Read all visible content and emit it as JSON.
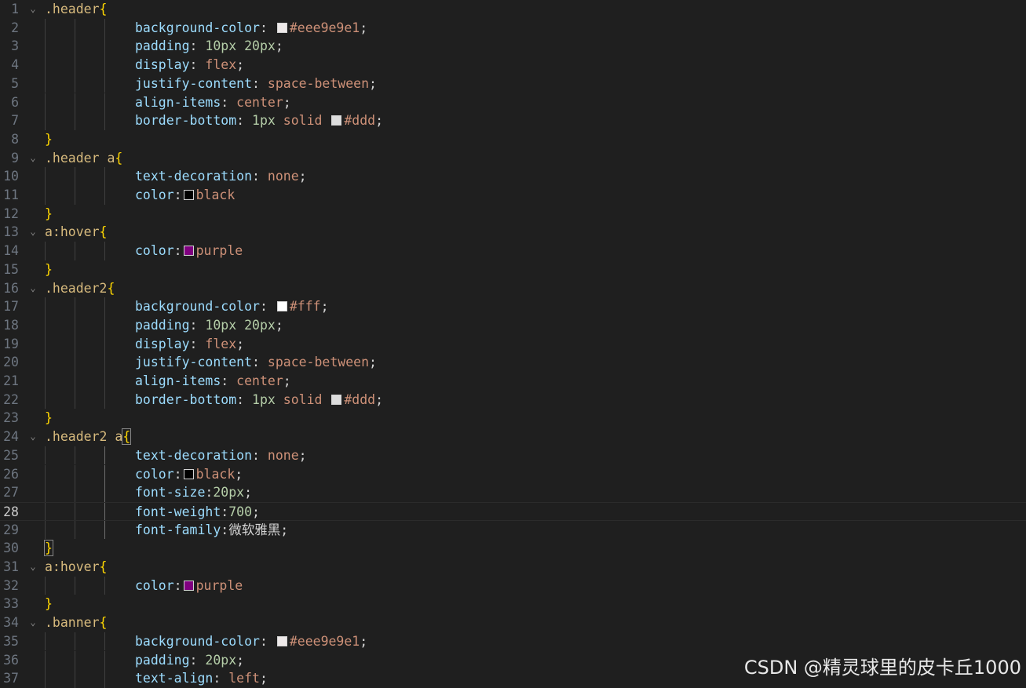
{
  "editor": {
    "current_line": 28,
    "lines": [
      {
        "n": "1",
        "fold": true,
        "indent": 0,
        "tokens": [
          {
            "t": ".header",
            "c": "sel"
          },
          {
            "t": "{",
            "c": "brace"
          }
        ]
      },
      {
        "n": "2",
        "fold": false,
        "indent": 1,
        "tokens": [
          {
            "t": "background-color",
            "c": "prop"
          },
          {
            "t": ": ",
            "c": "punc"
          },
          {
            "sw": "#eee9e9"
          },
          {
            "t": "#eee9e9e1",
            "c": "val"
          },
          {
            "t": ";",
            "c": "punc"
          }
        ]
      },
      {
        "n": "3",
        "fold": false,
        "indent": 1,
        "tokens": [
          {
            "t": "padding",
            "c": "prop"
          },
          {
            "t": ": ",
            "c": "punc"
          },
          {
            "t": "10px 20px",
            "c": "num"
          },
          {
            "t": ";",
            "c": "punc"
          }
        ]
      },
      {
        "n": "4",
        "fold": false,
        "indent": 1,
        "tokens": [
          {
            "t": "display",
            "c": "prop"
          },
          {
            "t": ": ",
            "c": "punc"
          },
          {
            "t": "flex",
            "c": "val"
          },
          {
            "t": ";",
            "c": "punc"
          }
        ]
      },
      {
        "n": "5",
        "fold": false,
        "indent": 1,
        "tokens": [
          {
            "t": "justify-content",
            "c": "prop"
          },
          {
            "t": ": ",
            "c": "punc"
          },
          {
            "t": "space-between",
            "c": "val"
          },
          {
            "t": ";",
            "c": "punc"
          }
        ]
      },
      {
        "n": "6",
        "fold": false,
        "indent": 1,
        "tokens": [
          {
            "t": "align-items",
            "c": "prop"
          },
          {
            "t": ": ",
            "c": "punc"
          },
          {
            "t": "center",
            "c": "val"
          },
          {
            "t": ";",
            "c": "punc"
          }
        ]
      },
      {
        "n": "7",
        "fold": false,
        "indent": 1,
        "tokens": [
          {
            "t": "border-bottom",
            "c": "prop"
          },
          {
            "t": ": ",
            "c": "punc"
          },
          {
            "t": "1px",
            "c": "num"
          },
          {
            "t": " solid ",
            "c": "val"
          },
          {
            "sw": "#dddddd"
          },
          {
            "t": "#ddd",
            "c": "val"
          },
          {
            "t": ";",
            "c": "punc"
          }
        ]
      },
      {
        "n": "8",
        "fold": false,
        "indent": 0,
        "tokens": [
          {
            "t": "}",
            "c": "brace"
          }
        ]
      },
      {
        "n": "9",
        "fold": true,
        "indent": 0,
        "tokens": [
          {
            "t": ".header a",
            "c": "sel"
          },
          {
            "t": "{",
            "c": "brace"
          }
        ]
      },
      {
        "n": "10",
        "fold": false,
        "indent": 1,
        "tokens": [
          {
            "t": "text-decoration",
            "c": "prop"
          },
          {
            "t": ": ",
            "c": "punc"
          },
          {
            "t": "none",
            "c": "val"
          },
          {
            "t": ";",
            "c": "punc"
          }
        ]
      },
      {
        "n": "11",
        "fold": false,
        "indent": 1,
        "tokens": [
          {
            "t": "color",
            "c": "prop"
          },
          {
            "t": ":",
            "c": "punc"
          },
          {
            "sw": "#000000"
          },
          {
            "t": "black",
            "c": "val"
          }
        ]
      },
      {
        "n": "12",
        "fold": false,
        "indent": 0,
        "tokens": [
          {
            "t": "}",
            "c": "brace"
          }
        ]
      },
      {
        "n": "13",
        "fold": true,
        "indent": 0,
        "tokens": [
          {
            "t": "a:hover",
            "c": "sel"
          },
          {
            "t": "{",
            "c": "brace"
          }
        ]
      },
      {
        "n": "14",
        "fold": false,
        "indent": 1,
        "tokens": [
          {
            "t": "color",
            "c": "prop"
          },
          {
            "t": ":",
            "c": "punc"
          },
          {
            "sw": "#800080"
          },
          {
            "t": "purple",
            "c": "val"
          }
        ]
      },
      {
        "n": "15",
        "fold": false,
        "indent": 0,
        "tokens": [
          {
            "t": "}",
            "c": "brace"
          }
        ]
      },
      {
        "n": "16",
        "fold": true,
        "indent": 0,
        "tokens": [
          {
            "t": ".header2",
            "c": "sel"
          },
          {
            "t": "{",
            "c": "brace"
          }
        ]
      },
      {
        "n": "17",
        "fold": false,
        "indent": 1,
        "tokens": [
          {
            "t": "background-color",
            "c": "prop"
          },
          {
            "t": ": ",
            "c": "punc"
          },
          {
            "sw": "#ffffff"
          },
          {
            "t": "#fff",
            "c": "val"
          },
          {
            "t": ";",
            "c": "punc"
          }
        ]
      },
      {
        "n": "18",
        "fold": false,
        "indent": 1,
        "tokens": [
          {
            "t": "padding",
            "c": "prop"
          },
          {
            "t": ": ",
            "c": "punc"
          },
          {
            "t": "10px 20px",
            "c": "num"
          },
          {
            "t": ";",
            "c": "punc"
          }
        ]
      },
      {
        "n": "19",
        "fold": false,
        "indent": 1,
        "tokens": [
          {
            "t": "display",
            "c": "prop"
          },
          {
            "t": ": ",
            "c": "punc"
          },
          {
            "t": "flex",
            "c": "val"
          },
          {
            "t": ";",
            "c": "punc"
          }
        ]
      },
      {
        "n": "20",
        "fold": false,
        "indent": 1,
        "tokens": [
          {
            "t": "justify-content",
            "c": "prop"
          },
          {
            "t": ": ",
            "c": "punc"
          },
          {
            "t": "space-between",
            "c": "val"
          },
          {
            "t": ";",
            "c": "punc"
          }
        ]
      },
      {
        "n": "21",
        "fold": false,
        "indent": 1,
        "tokens": [
          {
            "t": "align-items",
            "c": "prop"
          },
          {
            "t": ": ",
            "c": "punc"
          },
          {
            "t": "center",
            "c": "val"
          },
          {
            "t": ";",
            "c": "punc"
          }
        ]
      },
      {
        "n": "22",
        "fold": false,
        "indent": 1,
        "tokens": [
          {
            "t": "border-bottom",
            "c": "prop"
          },
          {
            "t": ": ",
            "c": "punc"
          },
          {
            "t": "1px",
            "c": "num"
          },
          {
            "t": " solid ",
            "c": "val"
          },
          {
            "sw": "#dddddd"
          },
          {
            "t": "#ddd",
            "c": "val"
          },
          {
            "t": ";",
            "c": "punc"
          }
        ]
      },
      {
        "n": "23",
        "fold": false,
        "indent": 0,
        "tokens": [
          {
            "t": "}",
            "c": "brace"
          }
        ]
      },
      {
        "n": "24",
        "fold": true,
        "indent": 0,
        "tokens": [
          {
            "t": ".header2 a",
            "c": "sel"
          },
          {
            "t": "{",
            "c": "brace match"
          }
        ]
      },
      {
        "n": "25",
        "fold": false,
        "indent": 1,
        "active_guide": true,
        "tokens": [
          {
            "t": "text-decoration",
            "c": "prop"
          },
          {
            "t": ": ",
            "c": "punc"
          },
          {
            "t": "none",
            "c": "val"
          },
          {
            "t": ";",
            "c": "punc"
          }
        ]
      },
      {
        "n": "26",
        "fold": false,
        "indent": 1,
        "active_guide": true,
        "tokens": [
          {
            "t": "color",
            "c": "prop"
          },
          {
            "t": ":",
            "c": "punc"
          },
          {
            "sw": "#000000"
          },
          {
            "t": "black",
            "c": "val"
          },
          {
            "t": ";",
            "c": "punc"
          }
        ]
      },
      {
        "n": "27",
        "fold": false,
        "indent": 1,
        "active_guide": true,
        "tokens": [
          {
            "t": "font-size",
            "c": "prop"
          },
          {
            "t": ":",
            "c": "punc"
          },
          {
            "t": "20px",
            "c": "num"
          },
          {
            "t": ";",
            "c": "punc"
          }
        ]
      },
      {
        "n": "28",
        "fold": false,
        "indent": 1,
        "active_guide": true,
        "tokens": [
          {
            "t": "font-weight",
            "c": "prop"
          },
          {
            "t": ":",
            "c": "punc"
          },
          {
            "t": "700",
            "c": "num"
          },
          {
            "t": ";",
            "c": "punc"
          }
        ]
      },
      {
        "n": "29",
        "fold": false,
        "indent": 1,
        "active_guide": true,
        "tokens": [
          {
            "t": "font-family",
            "c": "prop"
          },
          {
            "t": ":",
            "c": "punc"
          },
          {
            "t": "微软雅黑",
            "c": "punc"
          },
          {
            "t": ";",
            "c": "punc"
          }
        ]
      },
      {
        "n": "30",
        "fold": false,
        "indent": 0,
        "tokens": [
          {
            "t": "}",
            "c": "brace match"
          }
        ]
      },
      {
        "n": "31",
        "fold": true,
        "indent": 0,
        "tokens": [
          {
            "t": "a:hover",
            "c": "sel"
          },
          {
            "t": "{",
            "c": "brace"
          }
        ]
      },
      {
        "n": "32",
        "fold": false,
        "indent": 1,
        "tokens": [
          {
            "t": "color",
            "c": "prop"
          },
          {
            "t": ":",
            "c": "punc"
          },
          {
            "sw": "#800080"
          },
          {
            "t": "purple",
            "c": "val"
          }
        ]
      },
      {
        "n": "33",
        "fold": false,
        "indent": 0,
        "tokens": [
          {
            "t": "}",
            "c": "brace"
          }
        ]
      },
      {
        "n": "34",
        "fold": true,
        "indent": 0,
        "tokens": [
          {
            "t": ".banner",
            "c": "sel"
          },
          {
            "t": "{",
            "c": "brace"
          }
        ]
      },
      {
        "n": "35",
        "fold": false,
        "indent": 1,
        "tokens": [
          {
            "t": "background-color",
            "c": "prop"
          },
          {
            "t": ": ",
            "c": "punc"
          },
          {
            "sw": "#eee9e9"
          },
          {
            "t": "#eee9e9e1",
            "c": "val"
          },
          {
            "t": ";",
            "c": "punc"
          }
        ]
      },
      {
        "n": "36",
        "fold": false,
        "indent": 1,
        "tokens": [
          {
            "t": "padding",
            "c": "prop"
          },
          {
            "t": ": ",
            "c": "punc"
          },
          {
            "t": "20px",
            "c": "num"
          },
          {
            "t": ";",
            "c": "punc"
          }
        ]
      },
      {
        "n": "37",
        "fold": false,
        "indent": 1,
        "tokens": [
          {
            "t": "text-align",
            "c": "prop"
          },
          {
            "t": ": ",
            "c": "punc"
          },
          {
            "t": "left",
            "c": "val"
          },
          {
            "t": ";",
            "c": "punc"
          }
        ]
      }
    ]
  },
  "watermark": "CSDN @精灵球里的皮卡丘1000"
}
